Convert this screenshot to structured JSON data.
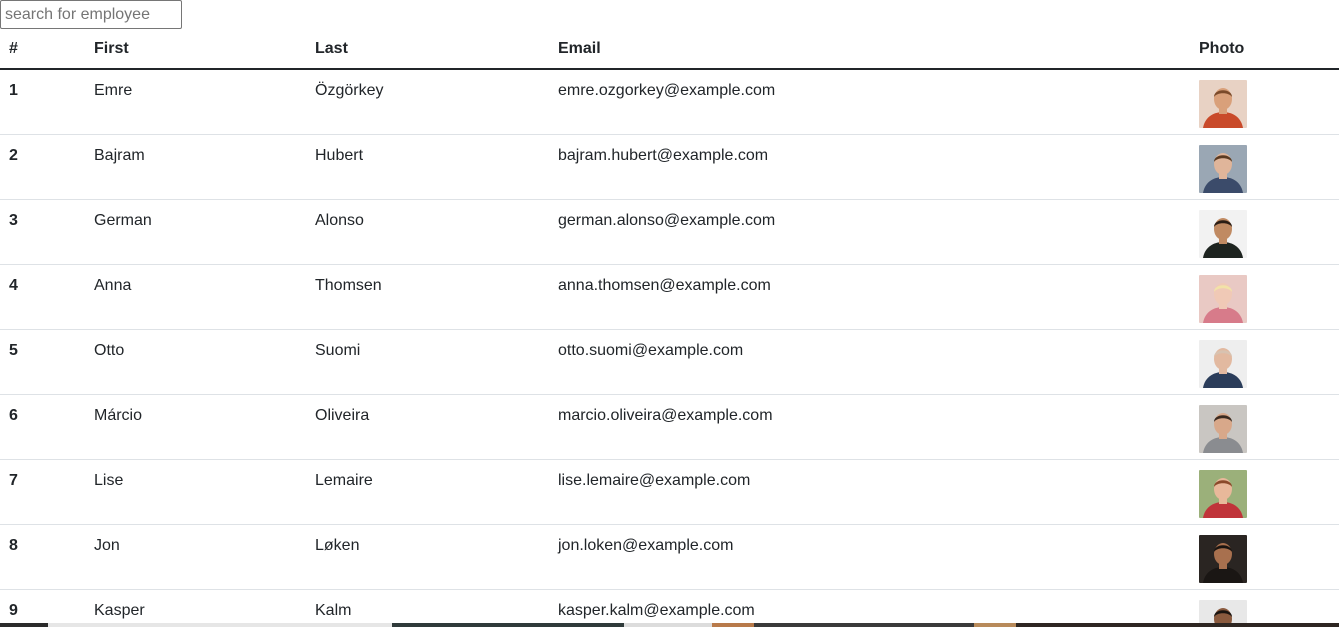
{
  "search": {
    "placeholder": "search for employee",
    "value": ""
  },
  "table": {
    "headers": {
      "num": "#",
      "first": "First",
      "last": "Last",
      "email": "Email",
      "photo": "Photo"
    },
    "rows": [
      {
        "num": "1",
        "first": "Emre",
        "last": "Özgörkey",
        "email": "emre.ozgorkey@example.com",
        "photo": {
          "bg": "#e8d2c4",
          "skin": "#d9a07a",
          "hair": "#7a4a2a",
          "shirt": "#c94a2a"
        }
      },
      {
        "num": "2",
        "first": "Bajram",
        "last": "Hubert",
        "email": "bajram.hubert@example.com",
        "photo": {
          "bg": "#9aa7b4",
          "skin": "#e0b59a",
          "hair": "#5a3a22",
          "shirt": "#3b4b6a"
        }
      },
      {
        "num": "3",
        "first": "German",
        "last": "Alonso",
        "email": "german.alonso@example.com",
        "photo": {
          "bg": "#f2f2f2",
          "skin": "#c08a62",
          "hair": "#2a1d14",
          "shirt": "#1e2420"
        }
      },
      {
        "num": "4",
        "first": "Anna",
        "last": "Thomsen",
        "email": "anna.thomsen@example.com",
        "photo": {
          "bg": "#e9c9c4",
          "skin": "#f0c9b6",
          "hair": "#f2e2a8",
          "shirt": "#d77b8a"
        }
      },
      {
        "num": "5",
        "first": "Otto",
        "last": "Suomi",
        "email": "otto.suomi@example.com",
        "photo": {
          "bg": "#eeeeee",
          "skin": "#e2b9a0",
          "hair": "#d8c2b0",
          "shirt": "#2b3d5a"
        }
      },
      {
        "num": "6",
        "first": "Márcio",
        "last": "Oliveira",
        "email": "marcio.oliveira@example.com",
        "photo": {
          "bg": "#c9c6c2",
          "skin": "#d8a88a",
          "hair": "#3a2a20",
          "shirt": "#8a8c90"
        }
      },
      {
        "num": "7",
        "first": "Lise",
        "last": "Lemaire",
        "email": "lise.lemaire@example.com",
        "photo": {
          "bg": "#9bb07a",
          "skin": "#e8b89a",
          "hair": "#8a4a2a",
          "shirt": "#c0343a"
        }
      },
      {
        "num": "8",
        "first": "Jon",
        "last": "Løken",
        "email": "jon.loken@example.com",
        "photo": {
          "bg": "#2a2522",
          "skin": "#a8704e",
          "hair": "#1a1410",
          "shirt": "#1a1614"
        }
      },
      {
        "num": "9",
        "first": "Kasper",
        "last": "Kalm",
        "email": "kasper.kalm@example.com",
        "photo": {
          "bg": "#e8e8e8",
          "skin": "#8a5a3e",
          "hair": "#1a1410",
          "shirt": "#2a2a2a"
        }
      }
    ]
  },
  "colors": {
    "header_rule": "#212529",
    "row_rule": "#dee2e6",
    "text": "#212529"
  }
}
